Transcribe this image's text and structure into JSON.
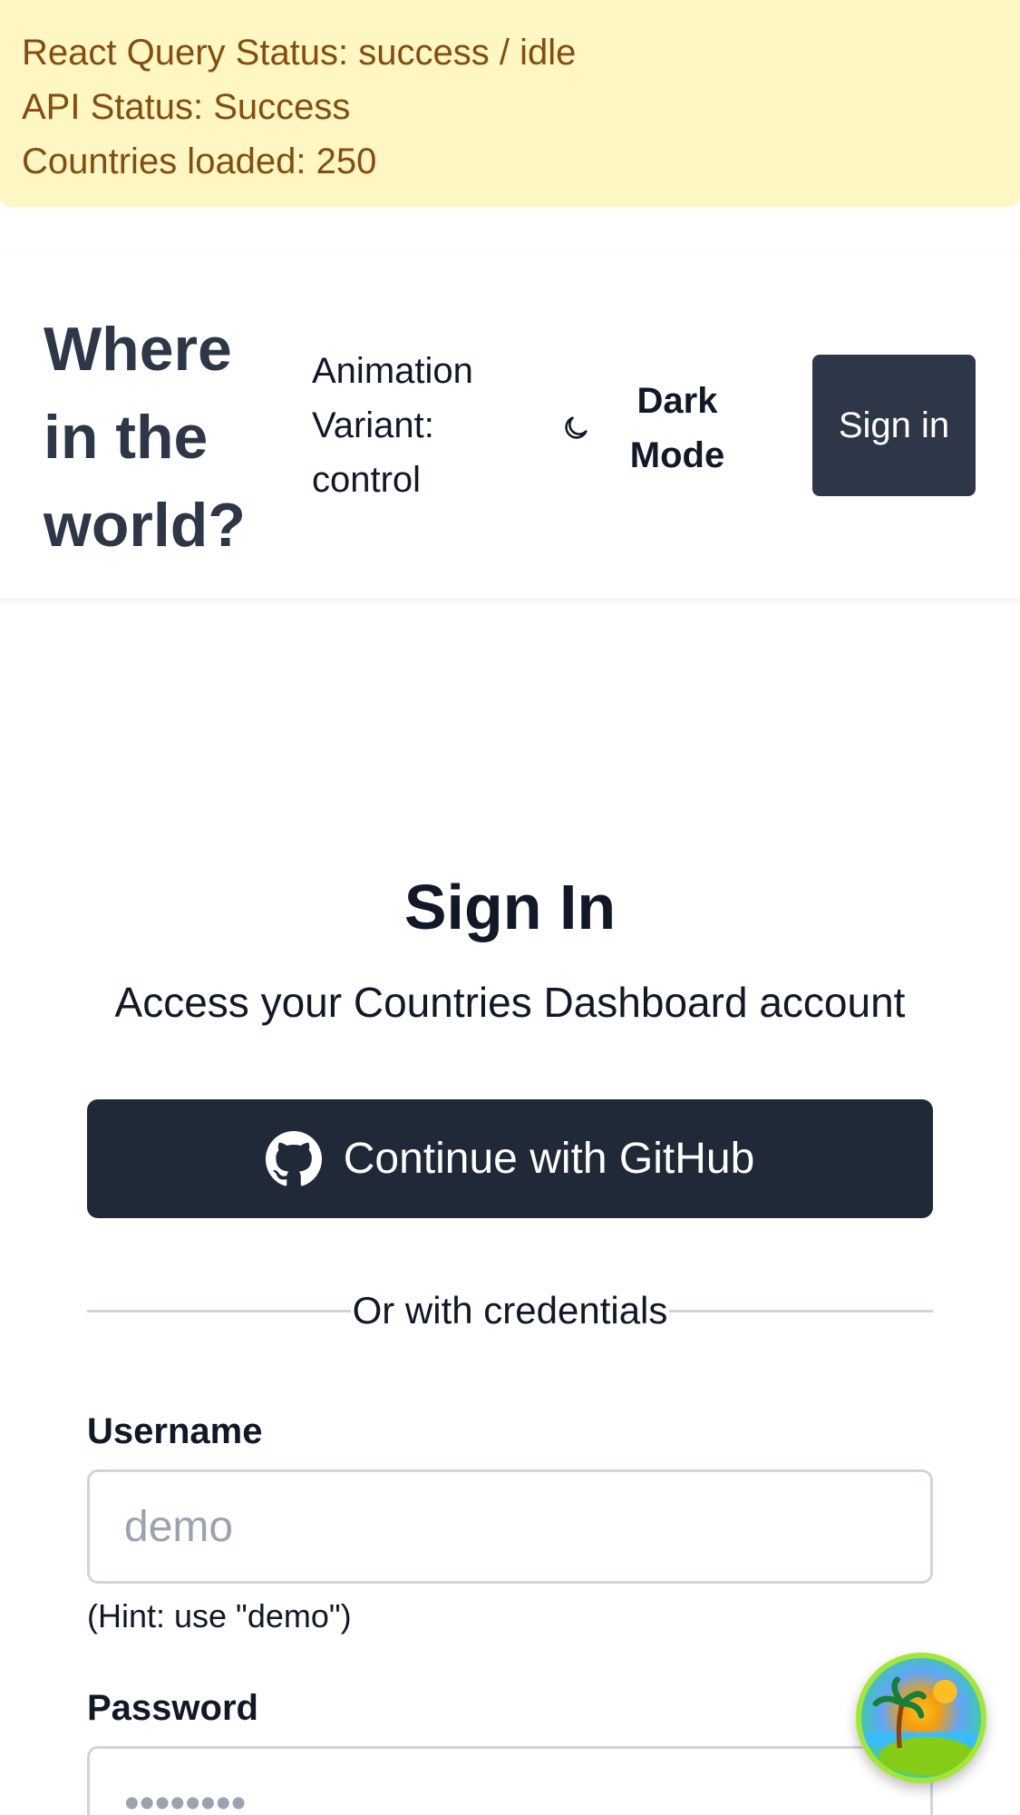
{
  "status": {
    "react_query": "React Query Status: success / idle",
    "api": "API Status: Success",
    "countries": "Countries loaded: 250"
  },
  "header": {
    "brand": "Where in the world?",
    "variant": "Animation Variant: control",
    "dark_mode": "Dark Mode",
    "sign_in": "Sign in"
  },
  "signin": {
    "title": "Sign In",
    "subtitle": "Access your Countries Dashboard account",
    "github_button": "Continue with GitHub",
    "divider": "Or with credentials",
    "username_label": "Username",
    "username_placeholder": "demo",
    "username_hint": "(Hint: use \"demo\")",
    "password_label": "Password",
    "password_placeholder": "••••••••"
  },
  "icons": {
    "moon": "moon-icon",
    "github": "github-icon",
    "badge": "island-badge-icon"
  },
  "colors": {
    "banner_bg": "#fef7c3",
    "banner_text": "#854d0e",
    "header_text": "#2d3748",
    "button_dark": "#1f2937"
  }
}
